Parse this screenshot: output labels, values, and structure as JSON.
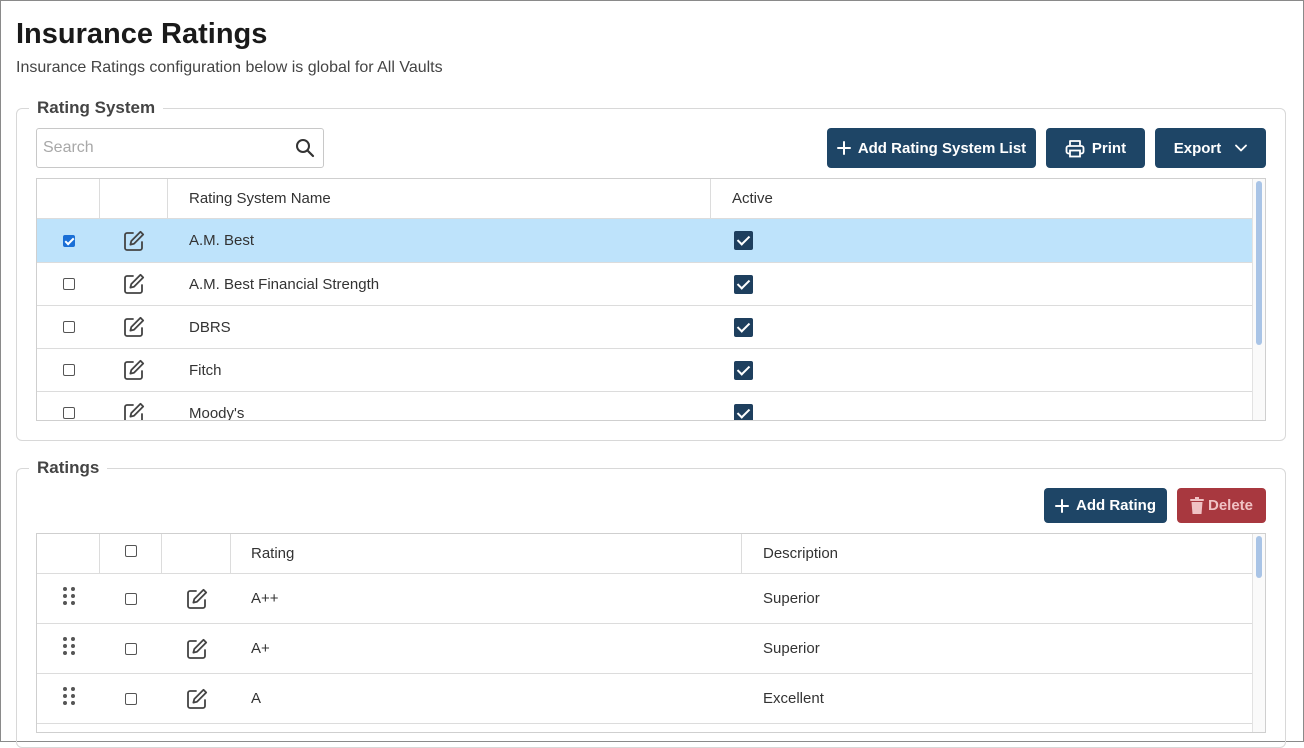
{
  "page": {
    "title": "Insurance Ratings",
    "subtitle": "Insurance Ratings configuration below is global for All Vaults"
  },
  "rating_system": {
    "legend": "Rating System",
    "search": {
      "placeholder": "Search",
      "value": ""
    },
    "buttons": {
      "add_list": "Add Rating System List",
      "print": "Print",
      "export": "Export"
    },
    "columns": {
      "name": "Rating System Name",
      "active": "Active"
    },
    "rows": [
      {
        "name": "A.M. Best",
        "selected": true,
        "active": true
      },
      {
        "name": "A.M. Best Financial Strength",
        "selected": false,
        "active": true
      },
      {
        "name": "DBRS",
        "selected": false,
        "active": true
      },
      {
        "name": "Fitch",
        "selected": false,
        "active": true
      },
      {
        "name": "Moody's",
        "selected": false,
        "active": true
      }
    ]
  },
  "ratings": {
    "legend": "Ratings",
    "buttons": {
      "add": "Add Rating",
      "delete": "Delete"
    },
    "columns": {
      "rating": "Rating",
      "description": "Description"
    },
    "rows": [
      {
        "rating": "A++",
        "description": "Superior"
      },
      {
        "rating": "A+",
        "description": "Superior"
      },
      {
        "rating": "A",
        "description": "Excellent"
      }
    ]
  },
  "colors": {
    "primary_button": "#1e4566",
    "delete_button": "#a8383f",
    "selected_row": "#bee3fb",
    "active_checkbox": "#1e3f5e"
  }
}
